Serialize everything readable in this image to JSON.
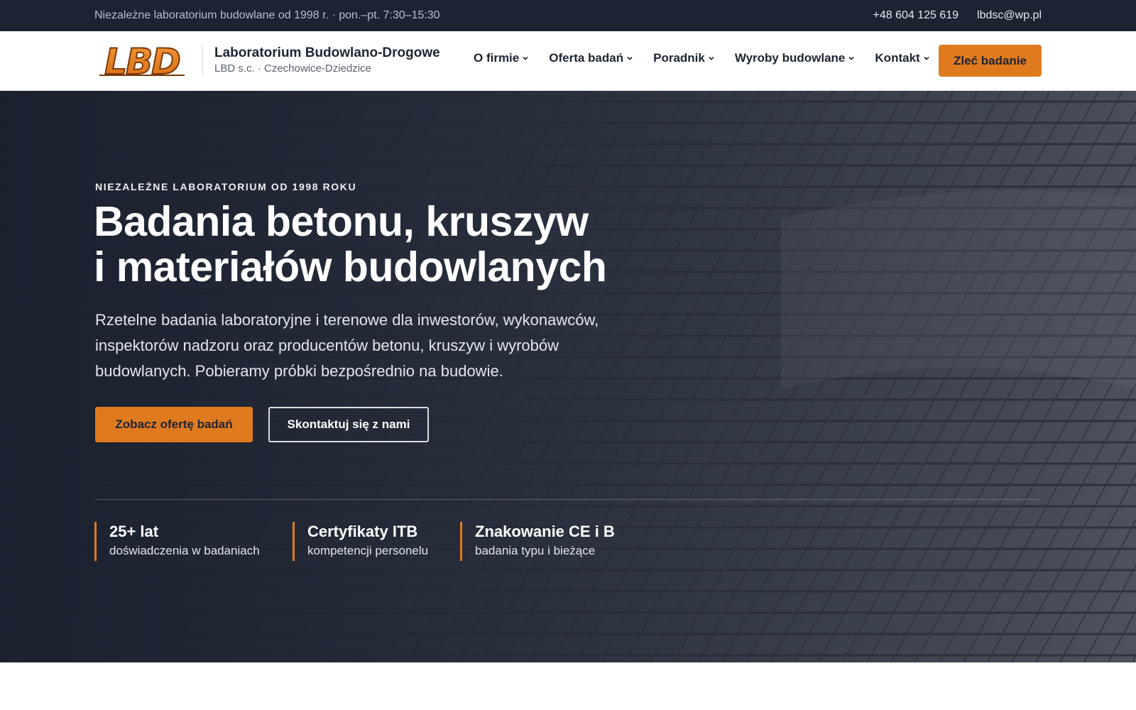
{
  "topbar": {
    "info": "Niezależne laboratorium budowlane od 1998 r. · pon.–pt. 7:30–15:30",
    "phone": "+48 604 125 619",
    "email": "lbdsc@wp.pl"
  },
  "brand": {
    "logo_text": "LBD",
    "name": "Laboratorium Budowlano-Drogowe",
    "subtitle": "LBD s.c. · Czechowice-Dziedzice",
    "accent_color": "#e07a1f"
  },
  "nav": {
    "items": [
      {
        "label": "O firmie",
        "icon": "chevron-down-icon"
      },
      {
        "label": "Oferta badań",
        "icon": "chevron-down-icon"
      },
      {
        "label": "Poradnik",
        "icon": "chevron-down-icon"
      },
      {
        "label": "Wyroby budowlane",
        "icon": "chevron-down-icon"
      },
      {
        "label": "Kontakt",
        "icon": "chevron-down-icon"
      }
    ],
    "cta_label": "Zleć badanie"
  },
  "hero": {
    "eyebrow": "NIEZALEŻNE LABORATORIUM OD 1998 ROKU",
    "headline_line1": "Badania betonu, kruszyw",
    "headline_line2": "i materiałów budowlanych",
    "lead": "Rzetelne badania laboratoryjne i terenowe dla inwestorów, wykonawców, inspektorów nadzoru oraz producentów betonu, kruszyw i wyrobów budowlanych. Pobieramy próbki bezpośrednio na budowie.",
    "primary_button": "Zobacz ofertę badań",
    "secondary_button": "Skontaktuj się z nami",
    "stats": [
      {
        "value": "25+ lat",
        "label": "doświadczenia w badaniach"
      },
      {
        "value": "Certyfikaty ITB",
        "label": "kompetencji personelu"
      },
      {
        "value": "Znakowanie CE i B",
        "label": "badania typu i bieżące"
      }
    ]
  }
}
